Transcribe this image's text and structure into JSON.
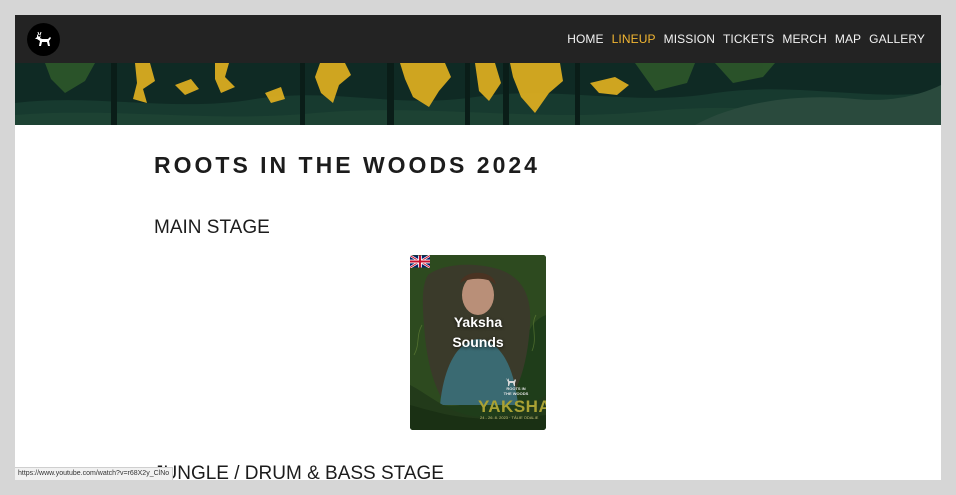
{
  "nav": {
    "logo_icon": "deer-logo-icon",
    "links": [
      {
        "label": "HOME",
        "active": false
      },
      {
        "label": "LINEUP",
        "active": true
      },
      {
        "label": "MISSION",
        "active": false
      },
      {
        "label": "TICKETS",
        "active": false
      },
      {
        "label": "MERCH",
        "active": false
      },
      {
        "label": "MAP",
        "active": false
      },
      {
        "label": "GALLERY",
        "active": false
      }
    ]
  },
  "page": {
    "title": "ROOTS IN THE WOODS 2024"
  },
  "stages": [
    {
      "name": "MAIN STAGE",
      "artists": [
        {
          "name_line1": "Yaksha",
          "name_line2": "Sounds",
          "flag_icon": "uk-flag-icon",
          "poster_brand_line1": "ROOTS IN",
          "poster_brand_line2": "THE WOODS",
          "poster_name": "YAKSHA",
          "poster_date": "24 - 26. 8. 2023 · TÁLIE ODALIE"
        }
      ]
    },
    {
      "name": "JUNGLE / DRUM & BASS STAGE",
      "artists": []
    }
  ],
  "status_bar": {
    "url": "https://www.youtube.com/watch?v=r68X2y_ClNo"
  },
  "colors": {
    "nav_bg": "#232323",
    "nav_active": "#f2b632",
    "forest_dark": "#0f2a24",
    "forest_gold": "#e0b020",
    "poster_green": "#1f3d1a",
    "poster_title": "#a9a234"
  }
}
